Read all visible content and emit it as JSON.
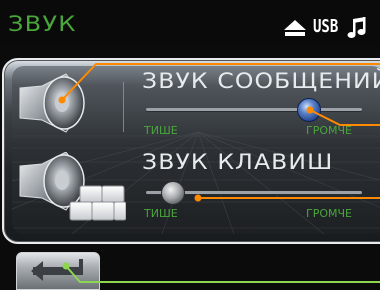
{
  "header": {
    "title": "ЗВУК",
    "status_icons": [
      "eject-icon",
      "usb-icon",
      "music-note-icon"
    ],
    "usb_label": "USB"
  },
  "rows": [
    {
      "title": "ЗВУК СООБЩЕНИЙ",
      "min_label": "ТИШЕ",
      "max_label": "ГРОМЧЕ",
      "icon": "speaker-icon",
      "level": 0.75
    },
    {
      "title": "ЗВУК КЛАВИШ",
      "min_label": "ТИШЕ",
      "max_label": "ГРОМЧЕ",
      "icon": "speaker-keys-icon",
      "level": 0.12
    }
  ],
  "footer": {
    "back_icon": "back-arrow-icon"
  },
  "colors": {
    "accent_green": "#4aa63b",
    "callout_orange": "#ff8a00",
    "callout_green": "#8dd650"
  }
}
